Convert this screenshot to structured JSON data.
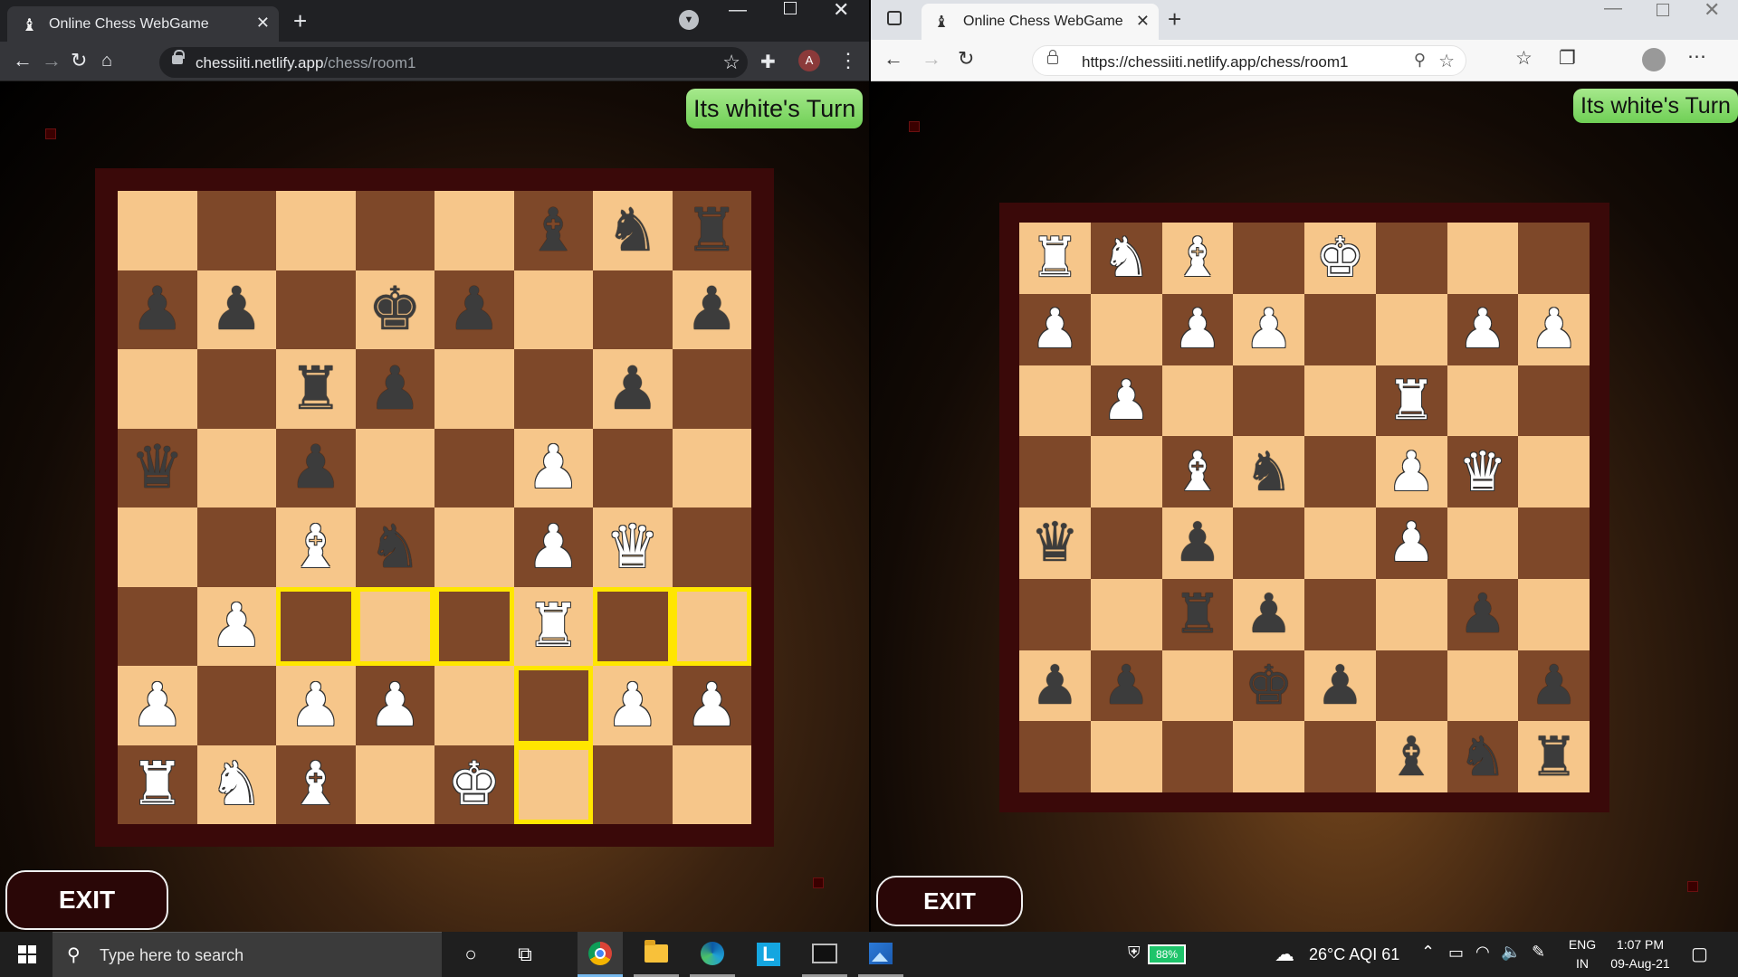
{
  "left_browser": {
    "tab_title": "Online Chess WebGame",
    "url_host": "chessiiti.netlify.app",
    "url_path": "/chess/room1",
    "avatar_letter": "A"
  },
  "right_browser": {
    "tab_title": "Online Chess WebGame",
    "url": "https://chessiiti.netlify.app/chess/room1"
  },
  "left_game": {
    "turn_text": "Its white's Turn",
    "exit_label": "EXIT",
    "board": [
      [
        "",
        "",
        "",
        "",
        "",
        "b",
        "n",
        "r"
      ],
      [
        "p",
        "p",
        "",
        "k",
        "p",
        "",
        "",
        "p"
      ],
      [
        "",
        "",
        "r",
        "p",
        "",
        "",
        "p",
        ""
      ],
      [
        "q",
        "",
        "p",
        "",
        "",
        "P",
        "",
        ""
      ],
      [
        "",
        "",
        "B",
        "n",
        "",
        "P",
        "Q",
        ""
      ],
      [
        "",
        "P",
        "",
        "",
        "",
        "R",
        "",
        ""
      ],
      [
        "P",
        "",
        "P",
        "P",
        "",
        "",
        "P",
        "P"
      ],
      [
        "R",
        "N",
        "B",
        "",
        "K",
        "",
        "",
        ""
      ]
    ],
    "highlights": [
      [
        5,
        2
      ],
      [
        5,
        3
      ],
      [
        5,
        4
      ],
      [
        5,
        6
      ],
      [
        5,
        7
      ],
      [
        6,
        5
      ],
      [
        7,
        5
      ]
    ]
  },
  "right_game": {
    "turn_text": "Its white's Turn",
    "exit_label": "EXIT",
    "board": [
      [
        "R",
        "N",
        "B",
        "",
        "K",
        "",
        "",
        ""
      ],
      [
        "P",
        "",
        "P",
        "P",
        "",
        "",
        "P",
        "P"
      ],
      [
        "",
        "P",
        "",
        "",
        "",
        "R",
        "",
        ""
      ],
      [
        "",
        "",
        "B",
        "n",
        "",
        "P",
        "Q",
        ""
      ],
      [
        "q",
        "",
        "p",
        "",
        "",
        "P",
        "",
        ""
      ],
      [
        "",
        "",
        "r",
        "p",
        "",
        "",
        "p",
        ""
      ],
      [
        "p",
        "p",
        "",
        "k",
        "p",
        "",
        "",
        "p"
      ],
      [
        "",
        "",
        "",
        "",
        "",
        "b",
        "n",
        "r"
      ]
    ],
    "highlights": []
  },
  "taskbar": {
    "search_placeholder": "Type here to search",
    "battery": "88%",
    "weather": "26°C  AQI 61",
    "lang_top": "ENG",
    "lang_bottom": "IN",
    "time": "1:07 PM",
    "date": "09-Aug-21"
  }
}
